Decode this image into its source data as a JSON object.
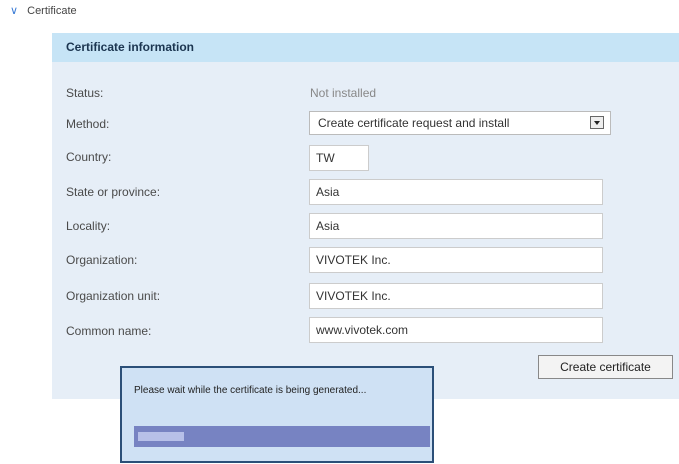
{
  "section": {
    "title": "Certificate",
    "expanded": true
  },
  "panel": {
    "title": "Certificate information"
  },
  "form": {
    "status_label": "Status:",
    "status_value": "Not installed",
    "method_label": "Method:",
    "method_value": "Create certificate request and install",
    "country_label": "Country:",
    "country_value": "TW",
    "state_label": "State or province:",
    "state_value": "Asia",
    "locality_label": "Locality:",
    "locality_value": "Asia",
    "org_label": "Organization:",
    "org_value": "VIVOTEK Inc.",
    "orgunit_label": "Organization unit:",
    "orgunit_value": "VIVOTEK Inc.",
    "cn_label": "Common name:",
    "cn_value": "www.vivotek.com"
  },
  "actions": {
    "create_label": "Create certificate"
  },
  "dialog": {
    "message": "Please wait while the certificate is being generated...",
    "progress_fraction": 0.16
  },
  "colors": {
    "accent": "#3a7bd5",
    "header_bg": "#c6e4f6",
    "panel_bg": "#e6eef7",
    "progress_track": "#7783c2"
  }
}
